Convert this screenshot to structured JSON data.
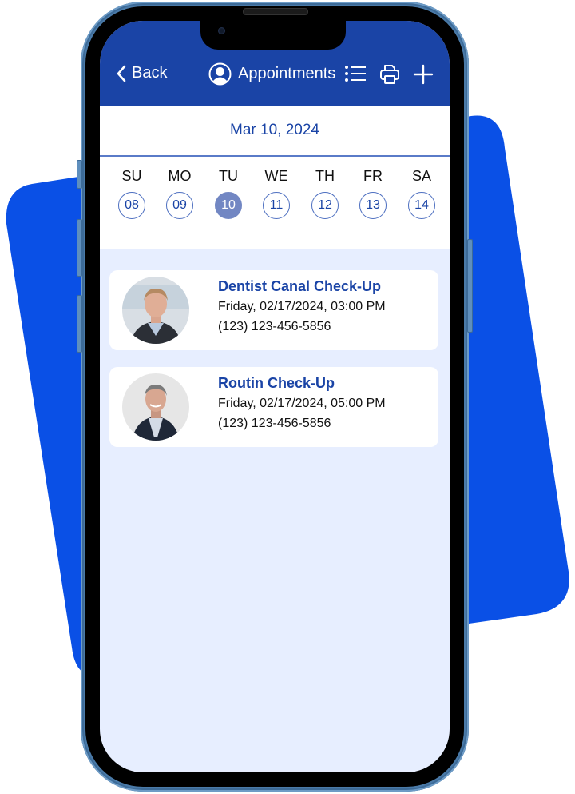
{
  "header": {
    "back_label": "Back",
    "title": "Appointments",
    "icons": [
      "user-circle-icon",
      "list-icon",
      "print-icon",
      "add-icon"
    ]
  },
  "date_bar": {
    "selected_date": "Mar 10, 2024"
  },
  "week": {
    "days": [
      {
        "label": "SU",
        "num": "08",
        "selected": false
      },
      {
        "label": "MO",
        "num": "09",
        "selected": false
      },
      {
        "label": "TU",
        "num": "10",
        "selected": true
      },
      {
        "label": "WE",
        "num": "11",
        "selected": false
      },
      {
        "label": "TH",
        "num": "12",
        "selected": false
      },
      {
        "label": "FR",
        "num": "13",
        "selected": false
      },
      {
        "label": "SA",
        "num": "14",
        "selected": false
      }
    ]
  },
  "appointments": [
    {
      "title": "Dentist Canal Check-Up",
      "datetime": "Friday, 02/17/2024, 03:00 PM",
      "phone": "(123) 123-456-5856"
    },
    {
      "title": "Routin Check-Up",
      "datetime": "Friday, 02/17/2024, 05:00 PM",
      "phone": "(123) 123-456-5856"
    }
  ],
  "colors": {
    "primary": "#1a44a6",
    "selected_day": "#7287c3",
    "screen_bg": "#e7eeff",
    "accent_shape": "#0a50e6",
    "phone_frame": "#4a7aa8"
  }
}
